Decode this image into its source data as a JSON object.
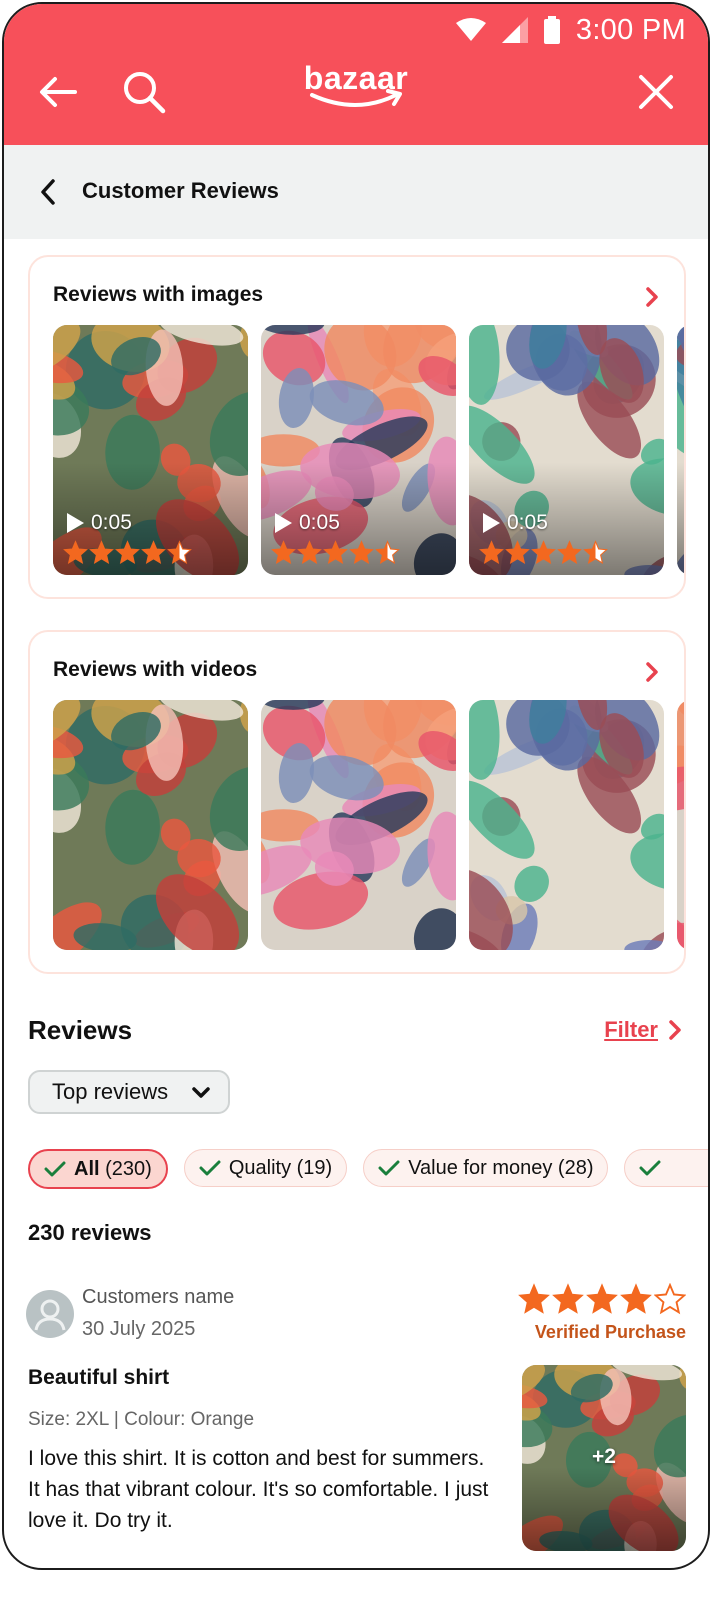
{
  "status_bar": {
    "time": "3:00 PM"
  },
  "app": {
    "logo_text": "bazaar",
    "brand_color": "#f7505a",
    "icons": {
      "back": "arrow-left-icon",
      "search": "search-icon",
      "close": "close-icon"
    }
  },
  "page": {
    "title": "Customer Reviews"
  },
  "media_sections": [
    {
      "title": "Reviews with images",
      "items": [
        {
          "duration": "0:05",
          "rating": 4.5
        },
        {
          "duration": "0:05",
          "rating": 4.5
        },
        {
          "duration": "0:05",
          "rating": 4.5
        }
      ]
    },
    {
      "title": "Reviews with videos",
      "items": [
        {},
        {},
        {}
      ]
    }
  ],
  "reviews": {
    "heading": "Reviews",
    "filter_label": "Filter",
    "sort": {
      "selected": "Top reviews"
    },
    "chips": [
      {
        "label": "All",
        "count": "(230)",
        "active": true
      },
      {
        "label": "Quality (19)",
        "active": false
      },
      {
        "label": "Value for money (28)",
        "active": false
      }
    ],
    "total_label": "230 reviews",
    "items": [
      {
        "name": "Customers name",
        "date": "30 July 2025",
        "rating": 4,
        "verified": "Verified Purchase",
        "title": "Beautiful shirt",
        "meta": "Size: 2XL | Colour: Orange",
        "body": "I love this shirt. It is cotton and best for summers. It has that vibrant colour. It's so comfortable. I just love it. Do try it.",
        "more_images": "+2"
      }
    ]
  },
  "colors": {
    "accent": "#e8424e",
    "star": "#f3681f",
    "verified": "#c4541a"
  }
}
